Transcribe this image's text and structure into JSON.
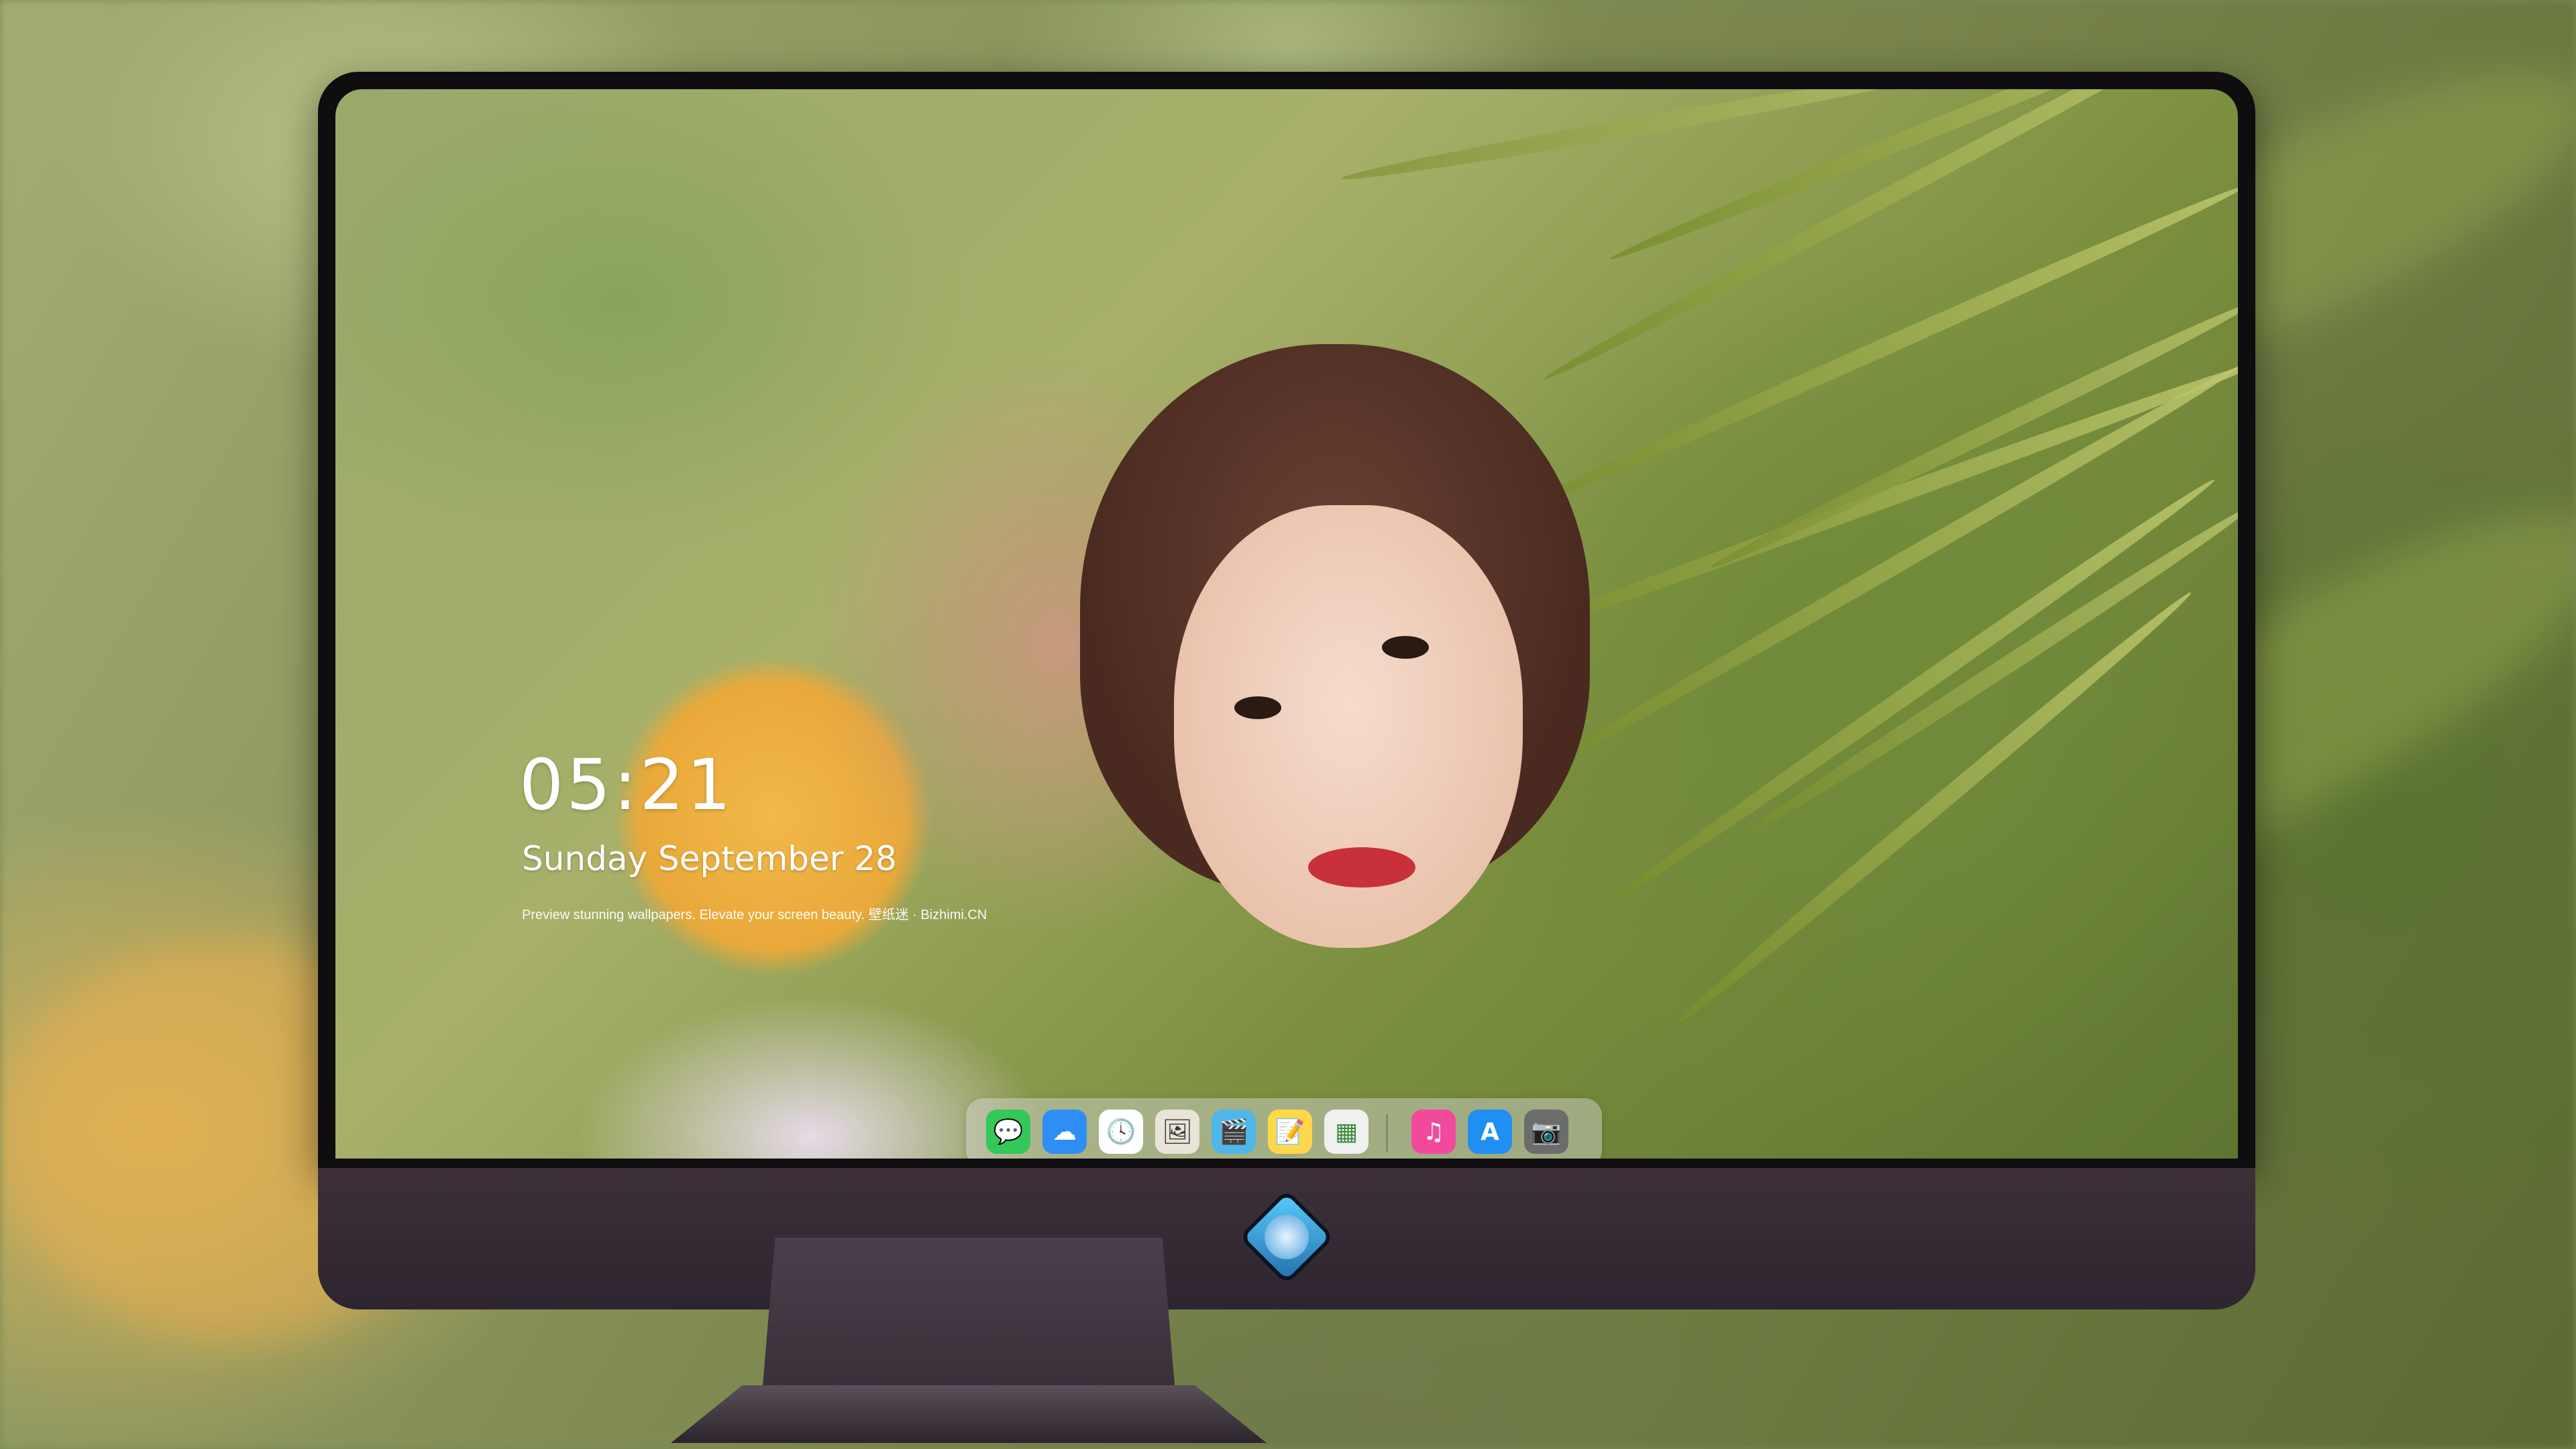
{
  "lock_screen": {
    "time": "05:21",
    "date": "Sunday September  28",
    "tagline": "Preview stunning wallpapers. Elevate your screen beauty. 壁纸迷 · Bizhimi.CN"
  },
  "dock": {
    "apps": [
      {
        "name": "messages-icon",
        "glyph": "💬",
        "color": "#34c759"
      },
      {
        "name": "weather-icon",
        "glyph": "☁",
        "color": "#2f8ef5"
      },
      {
        "name": "clock-icon",
        "glyph": "🕓",
        "color": "#ffffff"
      },
      {
        "name": "preview-icon",
        "glyph": "🖼",
        "color": "#e8e4d8"
      },
      {
        "name": "clips-icon",
        "glyph": "🎬",
        "color": "#4fb7e8"
      },
      {
        "name": "notes-icon",
        "glyph": "📝",
        "color": "#ffd74a"
      },
      {
        "name": "photos-widget-icon",
        "glyph": "▦",
        "color": "#f0f0f0"
      },
      {
        "name": "music-icon",
        "glyph": "♫",
        "color": "#f14a9c"
      },
      {
        "name": "app-store-icon",
        "glyph": "A",
        "color": "#1f90f2"
      },
      {
        "name": "camera-icon",
        "glyph": "📷",
        "color": "#6c6c6c"
      }
    ]
  },
  "colors": {
    "bezel": "#0f0d10",
    "chin": "#3d3038",
    "logo_accent": "#5bd0ff"
  }
}
